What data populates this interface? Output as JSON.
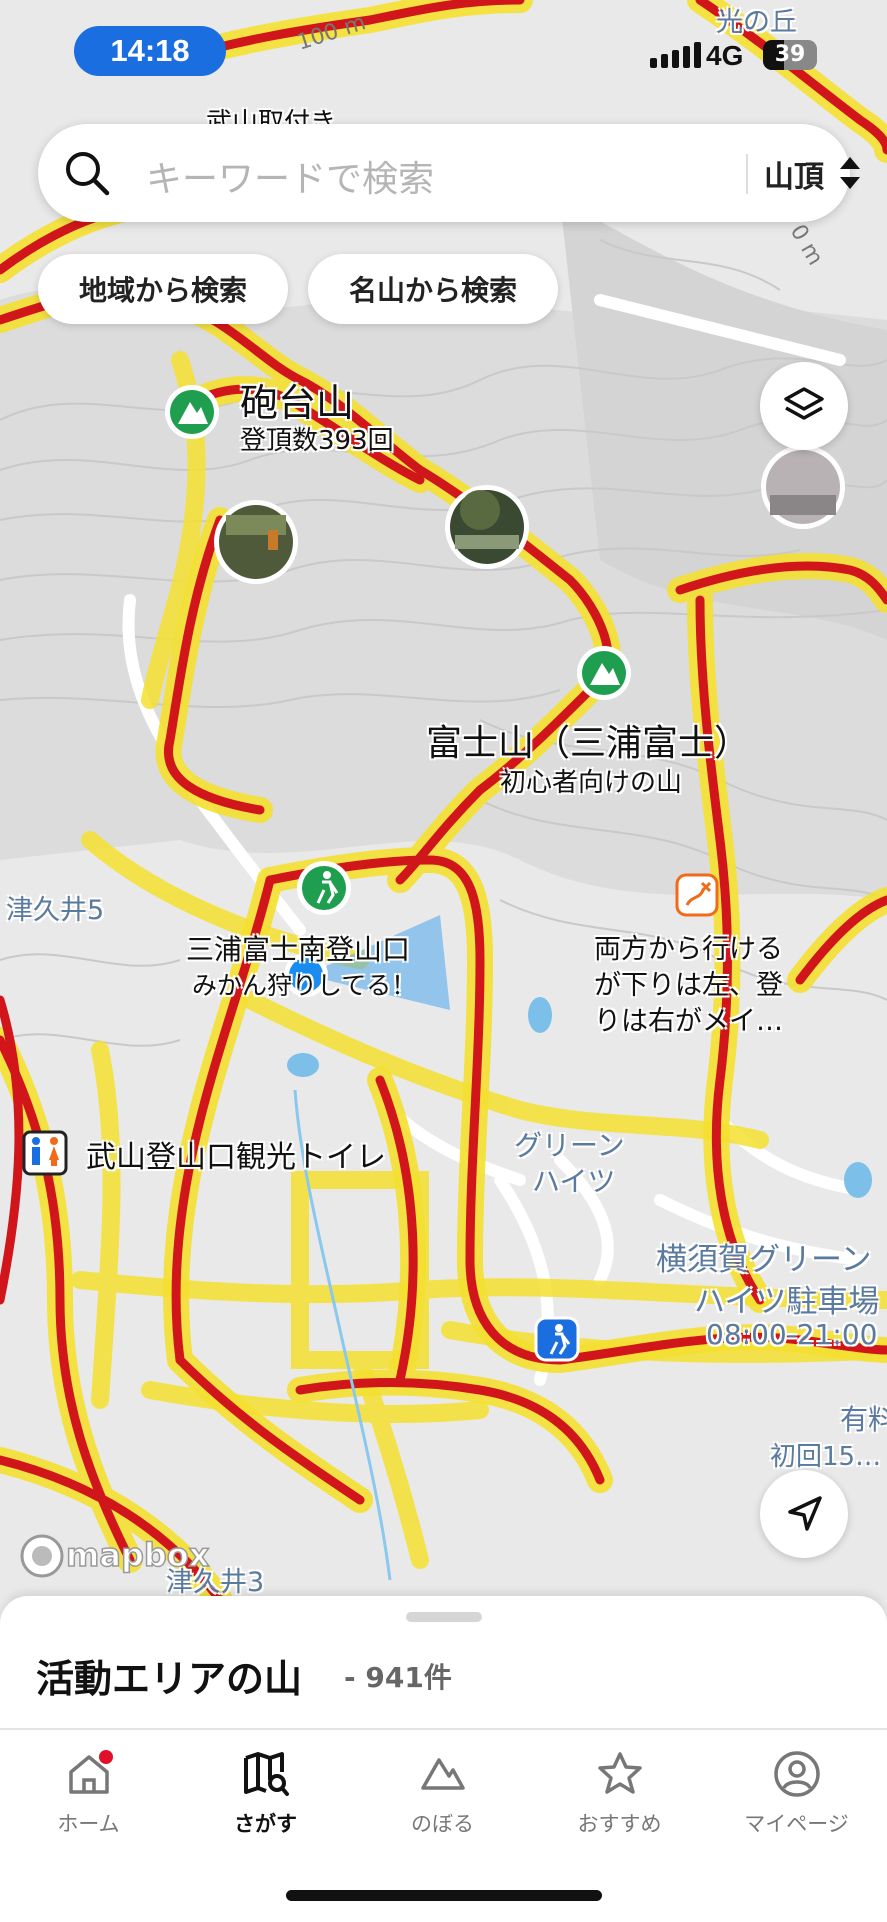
{
  "status_bar": {
    "time": "14:18",
    "network": "4G",
    "battery": "39",
    "battery_level": 0.39
  },
  "search": {
    "placeholder": "キーワードで検索",
    "filter_value": "山頂"
  },
  "chips": {
    "region": "地域から検索",
    "famous": "名山から検索"
  },
  "map": {
    "peaks": [
      {
        "name": "砲台山",
        "sub": "登頂数393回"
      },
      {
        "name": "富士山（三浦富士）",
        "sub": "初心者向けの山"
      }
    ],
    "trailhead": {
      "name": "三浦富士南登山口",
      "sub": "みかん狩りしてる！"
    },
    "note": {
      "lines": [
        "両方から行ける",
        "が下りは左、登",
        "りは右がメイ…"
      ]
    },
    "toilet": {
      "name": "武山登山口観光トイレ"
    },
    "parking": {
      "name_lines": [
        "横須賀グリーン",
        "ハイツ駐車場"
      ],
      "hours": "08:00-21:00"
    },
    "paid": {
      "line1": "有料",
      "line2": "初回15…"
    },
    "places": {
      "tsukui5": "津久井5",
      "tsukui3": "津久井3",
      "green_heights_1": "グリーン",
      "green_heights_2": "ハイツ",
      "hikari": "光の丘",
      "takeyama": "武山取付き"
    },
    "contour_labels": {
      "c100": "100 m",
      "c50": "0 m"
    },
    "attribution": "mapbox",
    "colors": {
      "trail": "#d0161b",
      "trail_glow": "#f5e030",
      "peak_icon": "#1e9e4e",
      "current_location": "#1a8cf0",
      "note_icon": "#f06a1a",
      "trailhead_icon": "#1a6ee0"
    }
  },
  "sheet": {
    "title": "活動エリアの山",
    "count": "- 941件"
  },
  "tabs": [
    {
      "label": "ホーム",
      "icon": "home-icon",
      "badge": true
    },
    {
      "label": "さがす",
      "icon": "map-search-icon",
      "active": true
    },
    {
      "label": "のぼる",
      "icon": "mountain-icon"
    },
    {
      "label": "おすすめ",
      "icon": "star-icon"
    },
    {
      "label": "マイページ",
      "icon": "profile-icon"
    }
  ]
}
